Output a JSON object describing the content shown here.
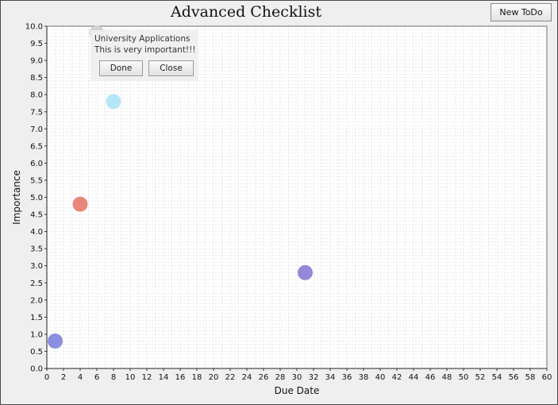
{
  "app": {
    "title": "Advanced Checklist",
    "new_button_label": "New ToDo"
  },
  "popup": {
    "title": "University Applications",
    "description": "This is very important!!!",
    "done_label": "Done",
    "close_label": "Close"
  },
  "chart_data": {
    "type": "scatter",
    "title": "Advanced Checklist",
    "xlabel": "Due Date",
    "ylabel": "Importance",
    "xlim": [
      0,
      60
    ],
    "ylim": [
      0,
      10
    ],
    "x_ticks": [
      "0",
      "2",
      "4",
      "6",
      "8",
      "10",
      "12",
      "14",
      "16",
      "18",
      "20",
      "22",
      "24",
      "26",
      "28",
      "30",
      "32",
      "34",
      "36",
      "38",
      "40",
      "42",
      "44",
      "46",
      "48",
      "50",
      "52",
      "54",
      "56",
      "58",
      "60"
    ],
    "y_ticks": [
      "0.0",
      "0.5",
      "1.0",
      "1.5",
      "2.0",
      "2.5",
      "3.0",
      "3.5",
      "4.0",
      "4.5",
      "5.0",
      "5.5",
      "6.0",
      "6.5",
      "7.0",
      "7.5",
      "8.0",
      "8.5",
      "9.0",
      "9.5",
      "10.0"
    ],
    "grid": true,
    "points": [
      {
        "x": 6,
        "y": 9.8,
        "color": "#d3d3cf"
      },
      {
        "x": 8,
        "y": 7.8,
        "color": "#b4e6f8"
      },
      {
        "x": 4,
        "y": 4.8,
        "color": "#e8867c"
      },
      {
        "x": 31,
        "y": 2.8,
        "color": "#9588d8"
      },
      {
        "x": 1,
        "y": 0.8,
        "color": "#8a8ee0"
      }
    ]
  }
}
